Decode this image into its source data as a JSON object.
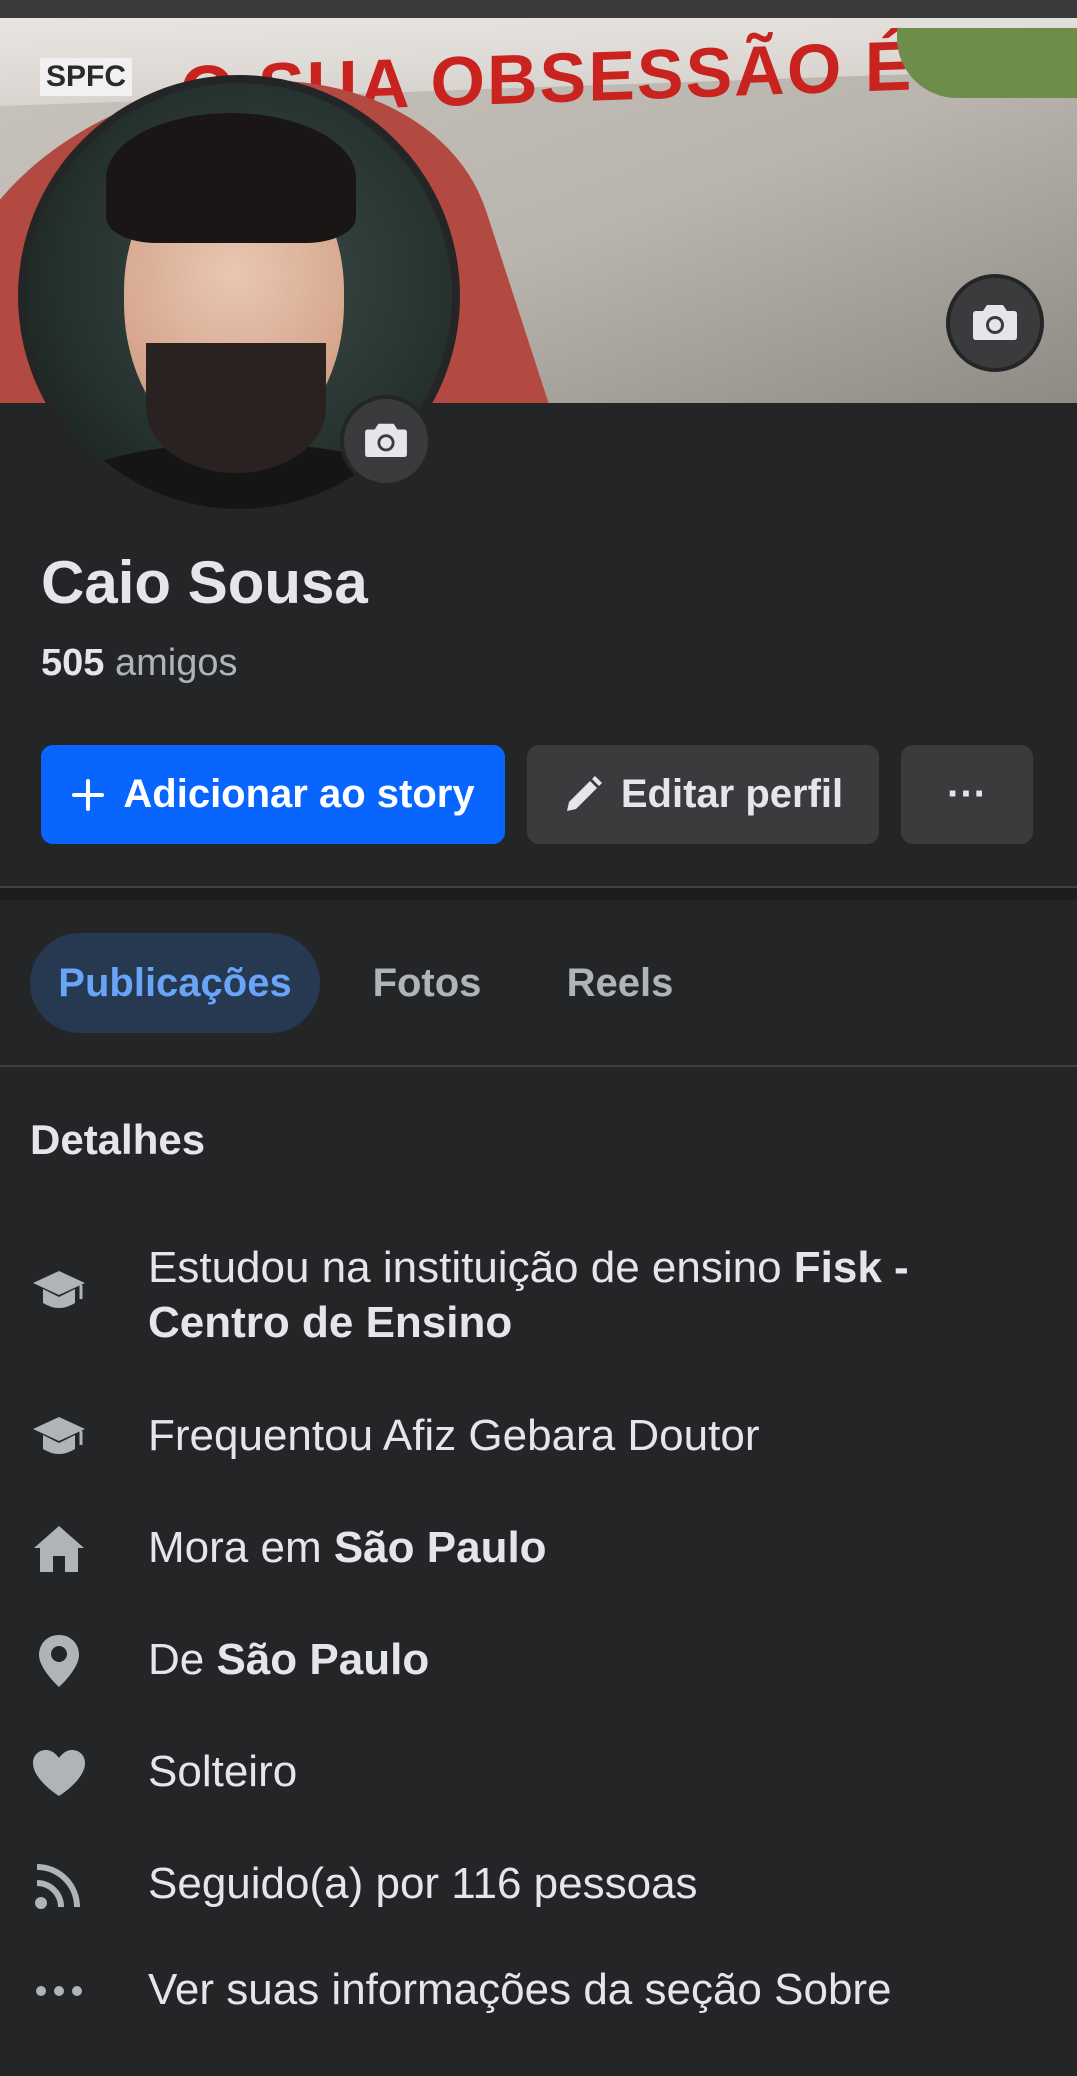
{
  "cover": {
    "banner_text": "O SUA OBSESSÃO É A MINHA HISTÓRIA",
    "badge_text": "SPFC"
  },
  "profile": {
    "name": "Caio Sousa",
    "friends_count": "505",
    "friends_label": "amigos"
  },
  "actions": {
    "add_story": "Adicionar ao story",
    "edit_profile": "Editar perfil",
    "more": "···"
  },
  "tabs": [
    {
      "label": "Publicações",
      "active": true
    },
    {
      "label": "Fotos",
      "active": false
    },
    {
      "label": "Reels",
      "active": false
    }
  ],
  "details": {
    "title": "Detalhes",
    "items": [
      {
        "icon": "graduation-cap-icon",
        "prefix": "Estudou na instituição de ensino ",
        "bold": "Fisk - Centro de Ensino"
      },
      {
        "icon": "graduation-cap-icon",
        "prefix": "Frequentou Afiz Gebara Doutor",
        "bold": ""
      },
      {
        "icon": "home-icon",
        "prefix": "Mora em ",
        "bold": "São Paulo"
      },
      {
        "icon": "location-pin-icon",
        "prefix": "De ",
        "bold": "São Paulo"
      },
      {
        "icon": "heart-icon",
        "prefix": "Solteiro",
        "bold": ""
      },
      {
        "icon": "rss-feed-icon",
        "prefix": "Seguido(a) por 116 pessoas",
        "bold": ""
      },
      {
        "icon": "more-dots-icon",
        "prefix": "Ver suas informações da seção Sobre",
        "bold": ""
      }
    ]
  },
  "colors": {
    "background": "#242526",
    "primary_button": "#0866ff",
    "secondary_button": "#3a3b3c",
    "active_tab_bg": "#263951",
    "active_tab_text": "#68a4f7"
  }
}
